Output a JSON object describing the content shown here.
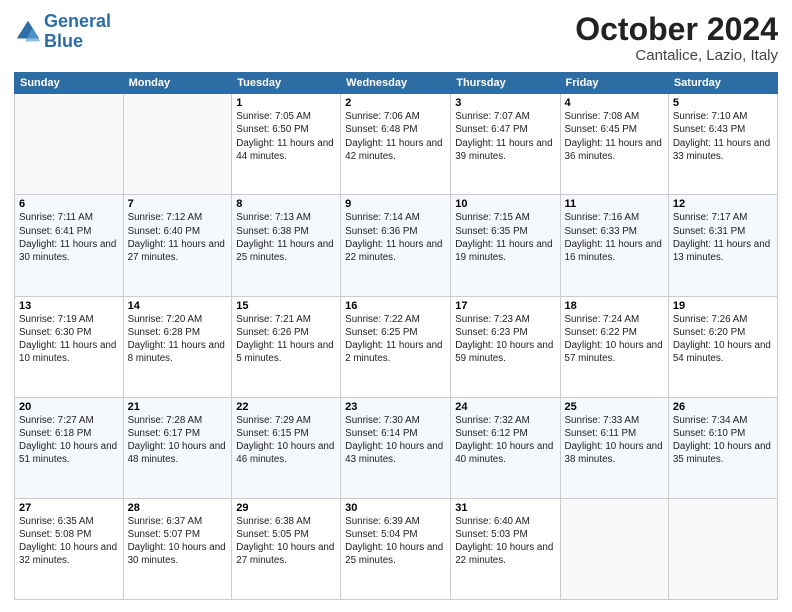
{
  "header": {
    "logo_line1": "General",
    "logo_line2": "Blue",
    "month_title": "October 2024",
    "location": "Cantalice, Lazio, Italy"
  },
  "weekdays": [
    "Sunday",
    "Monday",
    "Tuesday",
    "Wednesday",
    "Thursday",
    "Friday",
    "Saturday"
  ],
  "weeks": [
    [
      {
        "day": "",
        "sunrise": "",
        "sunset": "",
        "daylight": ""
      },
      {
        "day": "",
        "sunrise": "",
        "sunset": "",
        "daylight": ""
      },
      {
        "day": "1",
        "sunrise": "Sunrise: 7:05 AM",
        "sunset": "Sunset: 6:50 PM",
        "daylight": "Daylight: 11 hours and 44 minutes."
      },
      {
        "day": "2",
        "sunrise": "Sunrise: 7:06 AM",
        "sunset": "Sunset: 6:48 PM",
        "daylight": "Daylight: 11 hours and 42 minutes."
      },
      {
        "day": "3",
        "sunrise": "Sunrise: 7:07 AM",
        "sunset": "Sunset: 6:47 PM",
        "daylight": "Daylight: 11 hours and 39 minutes."
      },
      {
        "day": "4",
        "sunrise": "Sunrise: 7:08 AM",
        "sunset": "Sunset: 6:45 PM",
        "daylight": "Daylight: 11 hours and 36 minutes."
      },
      {
        "day": "5",
        "sunrise": "Sunrise: 7:10 AM",
        "sunset": "Sunset: 6:43 PM",
        "daylight": "Daylight: 11 hours and 33 minutes."
      }
    ],
    [
      {
        "day": "6",
        "sunrise": "Sunrise: 7:11 AM",
        "sunset": "Sunset: 6:41 PM",
        "daylight": "Daylight: 11 hours and 30 minutes."
      },
      {
        "day": "7",
        "sunrise": "Sunrise: 7:12 AM",
        "sunset": "Sunset: 6:40 PM",
        "daylight": "Daylight: 11 hours and 27 minutes."
      },
      {
        "day": "8",
        "sunrise": "Sunrise: 7:13 AM",
        "sunset": "Sunset: 6:38 PM",
        "daylight": "Daylight: 11 hours and 25 minutes."
      },
      {
        "day": "9",
        "sunrise": "Sunrise: 7:14 AM",
        "sunset": "Sunset: 6:36 PM",
        "daylight": "Daylight: 11 hours and 22 minutes."
      },
      {
        "day": "10",
        "sunrise": "Sunrise: 7:15 AM",
        "sunset": "Sunset: 6:35 PM",
        "daylight": "Daylight: 11 hours and 19 minutes."
      },
      {
        "day": "11",
        "sunrise": "Sunrise: 7:16 AM",
        "sunset": "Sunset: 6:33 PM",
        "daylight": "Daylight: 11 hours and 16 minutes."
      },
      {
        "day": "12",
        "sunrise": "Sunrise: 7:17 AM",
        "sunset": "Sunset: 6:31 PM",
        "daylight": "Daylight: 11 hours and 13 minutes."
      }
    ],
    [
      {
        "day": "13",
        "sunrise": "Sunrise: 7:19 AM",
        "sunset": "Sunset: 6:30 PM",
        "daylight": "Daylight: 11 hours and 10 minutes."
      },
      {
        "day": "14",
        "sunrise": "Sunrise: 7:20 AM",
        "sunset": "Sunset: 6:28 PM",
        "daylight": "Daylight: 11 hours and 8 minutes."
      },
      {
        "day": "15",
        "sunrise": "Sunrise: 7:21 AM",
        "sunset": "Sunset: 6:26 PM",
        "daylight": "Daylight: 11 hours and 5 minutes."
      },
      {
        "day": "16",
        "sunrise": "Sunrise: 7:22 AM",
        "sunset": "Sunset: 6:25 PM",
        "daylight": "Daylight: 11 hours and 2 minutes."
      },
      {
        "day": "17",
        "sunrise": "Sunrise: 7:23 AM",
        "sunset": "Sunset: 6:23 PM",
        "daylight": "Daylight: 10 hours and 59 minutes."
      },
      {
        "day": "18",
        "sunrise": "Sunrise: 7:24 AM",
        "sunset": "Sunset: 6:22 PM",
        "daylight": "Daylight: 10 hours and 57 minutes."
      },
      {
        "day": "19",
        "sunrise": "Sunrise: 7:26 AM",
        "sunset": "Sunset: 6:20 PM",
        "daylight": "Daylight: 10 hours and 54 minutes."
      }
    ],
    [
      {
        "day": "20",
        "sunrise": "Sunrise: 7:27 AM",
        "sunset": "Sunset: 6:18 PM",
        "daylight": "Daylight: 10 hours and 51 minutes."
      },
      {
        "day": "21",
        "sunrise": "Sunrise: 7:28 AM",
        "sunset": "Sunset: 6:17 PM",
        "daylight": "Daylight: 10 hours and 48 minutes."
      },
      {
        "day": "22",
        "sunrise": "Sunrise: 7:29 AM",
        "sunset": "Sunset: 6:15 PM",
        "daylight": "Daylight: 10 hours and 46 minutes."
      },
      {
        "day": "23",
        "sunrise": "Sunrise: 7:30 AM",
        "sunset": "Sunset: 6:14 PM",
        "daylight": "Daylight: 10 hours and 43 minutes."
      },
      {
        "day": "24",
        "sunrise": "Sunrise: 7:32 AM",
        "sunset": "Sunset: 6:12 PM",
        "daylight": "Daylight: 10 hours and 40 minutes."
      },
      {
        "day": "25",
        "sunrise": "Sunrise: 7:33 AM",
        "sunset": "Sunset: 6:11 PM",
        "daylight": "Daylight: 10 hours and 38 minutes."
      },
      {
        "day": "26",
        "sunrise": "Sunrise: 7:34 AM",
        "sunset": "Sunset: 6:10 PM",
        "daylight": "Daylight: 10 hours and 35 minutes."
      }
    ],
    [
      {
        "day": "27",
        "sunrise": "Sunrise: 6:35 AM",
        "sunset": "Sunset: 5:08 PM",
        "daylight": "Daylight: 10 hours and 32 minutes."
      },
      {
        "day": "28",
        "sunrise": "Sunrise: 6:37 AM",
        "sunset": "Sunset: 5:07 PM",
        "daylight": "Daylight: 10 hours and 30 minutes."
      },
      {
        "day": "29",
        "sunrise": "Sunrise: 6:38 AM",
        "sunset": "Sunset: 5:05 PM",
        "daylight": "Daylight: 10 hours and 27 minutes."
      },
      {
        "day": "30",
        "sunrise": "Sunrise: 6:39 AM",
        "sunset": "Sunset: 5:04 PM",
        "daylight": "Daylight: 10 hours and 25 minutes."
      },
      {
        "day": "31",
        "sunrise": "Sunrise: 6:40 AM",
        "sunset": "Sunset: 5:03 PM",
        "daylight": "Daylight: 10 hours and 22 minutes."
      },
      {
        "day": "",
        "sunrise": "",
        "sunset": "",
        "daylight": ""
      },
      {
        "day": "",
        "sunrise": "",
        "sunset": "",
        "daylight": ""
      }
    ]
  ]
}
